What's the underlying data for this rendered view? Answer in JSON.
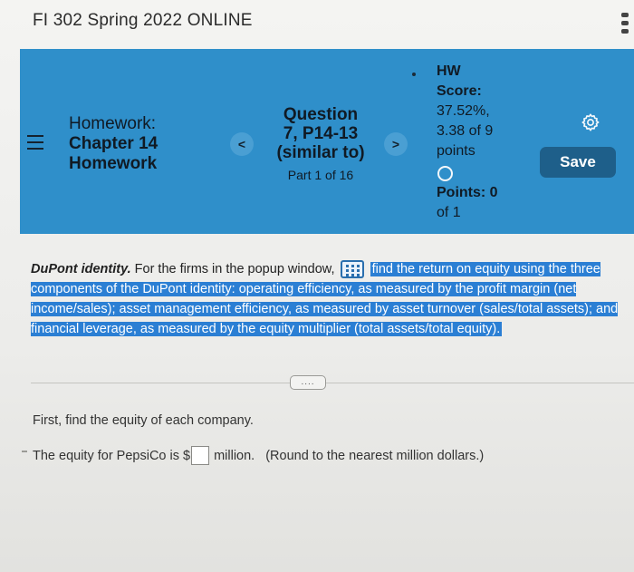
{
  "course": {
    "title": "FI 302 Spring 2022 ONLINE"
  },
  "header": {
    "homework_lines": [
      "Homework:",
      "Chapter 14",
      "Homework"
    ],
    "prev_label": "<",
    "next_label": ">",
    "question_lines": [
      "Question",
      "7, P14-13",
      "(similar to)"
    ],
    "part_label": "Part 1 of 16",
    "score": {
      "label_lines": [
        "HW",
        "Score:"
      ],
      "value_lines": [
        "37.52%,",
        "3.38 of 9",
        "points"
      ],
      "points_label": "Points:",
      "points_value": "0",
      "points_of": "of 1"
    },
    "save_label": "Save"
  },
  "problem": {
    "title": "DuPont identity.",
    "intro": "For the firms in the popup window,",
    "highlighted": "find the return on equity using the three components of the DuPont identity: operating efficiency, as measured by the profit margin (net income/sales); asset management efficiency, as measured by asset turnover (sales/total assets); and financial leverage, as measured by the equity multiplier (total assets/total equity)."
  },
  "more_label": "....",
  "step": {
    "instruction": "First, find the equity of each company.",
    "question_prefix": "The equity for PepsiCo is $",
    "question_suffix": "million.",
    "rounding_note": "(Round to the nearest million dollars.)"
  },
  "colors": {
    "header_bg": "#2f8fca",
    "save_bg": "#1e5f8a",
    "highlight": "#2b7fd4"
  },
  "icons": [
    "menu-icon",
    "gear-icon",
    "circle-icon",
    "grid-icon",
    "kebab-icon"
  ]
}
